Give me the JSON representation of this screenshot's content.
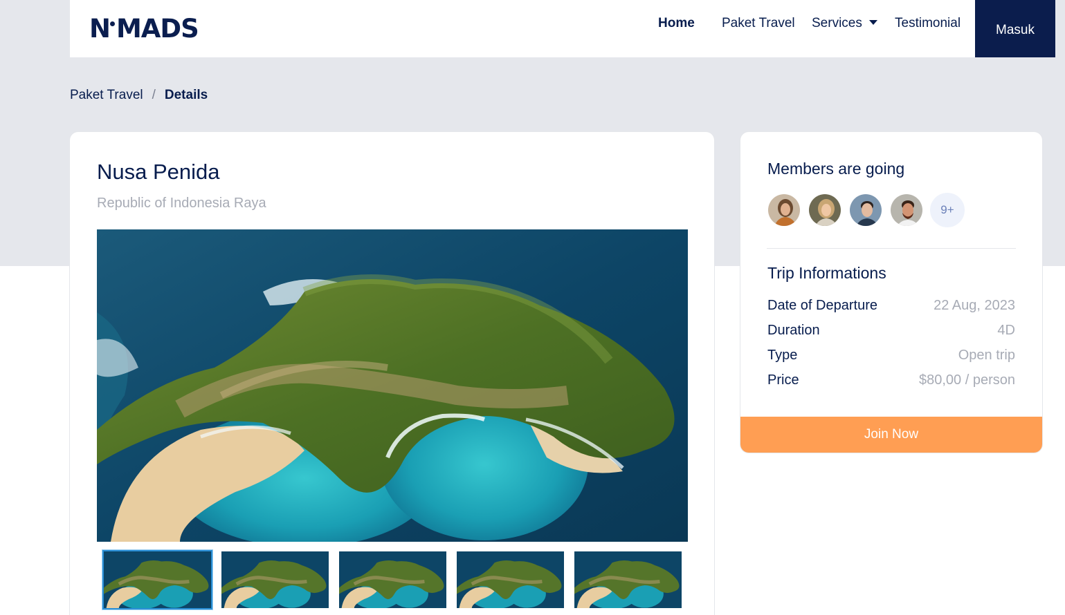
{
  "brand": {
    "logo_text_left": "N",
    "logo_text_right": "MADS"
  },
  "nav": {
    "home": "Home",
    "paket_travel": "Paket Travel",
    "services": "Services",
    "testimonial": "Testimonial",
    "login": "Masuk"
  },
  "breadcrumb": {
    "parent": "Paket Travel",
    "separator": "/",
    "current": "Details"
  },
  "details": {
    "title": "Nusa Penida",
    "location": "Republic of Indonesia Raya",
    "gallery_count": 5
  },
  "members": {
    "title": "Members are going",
    "more_label": "9+"
  },
  "trip": {
    "title": "Trip Informations",
    "rows": [
      {
        "label": "Date of Departure",
        "value": "22 Aug, 2023"
      },
      {
        "label": "Duration",
        "value": "4D"
      },
      {
        "label": "Type",
        "value": "Open trip"
      },
      {
        "label": "Price",
        "value": "$80,00 / person"
      }
    ],
    "cta": "Join Now"
  },
  "colors": {
    "navy": "#0b1d4d",
    "accent_orange": "#ff9e53",
    "muted_text": "#a7abb5",
    "page_grey": "#e5e7ec"
  }
}
